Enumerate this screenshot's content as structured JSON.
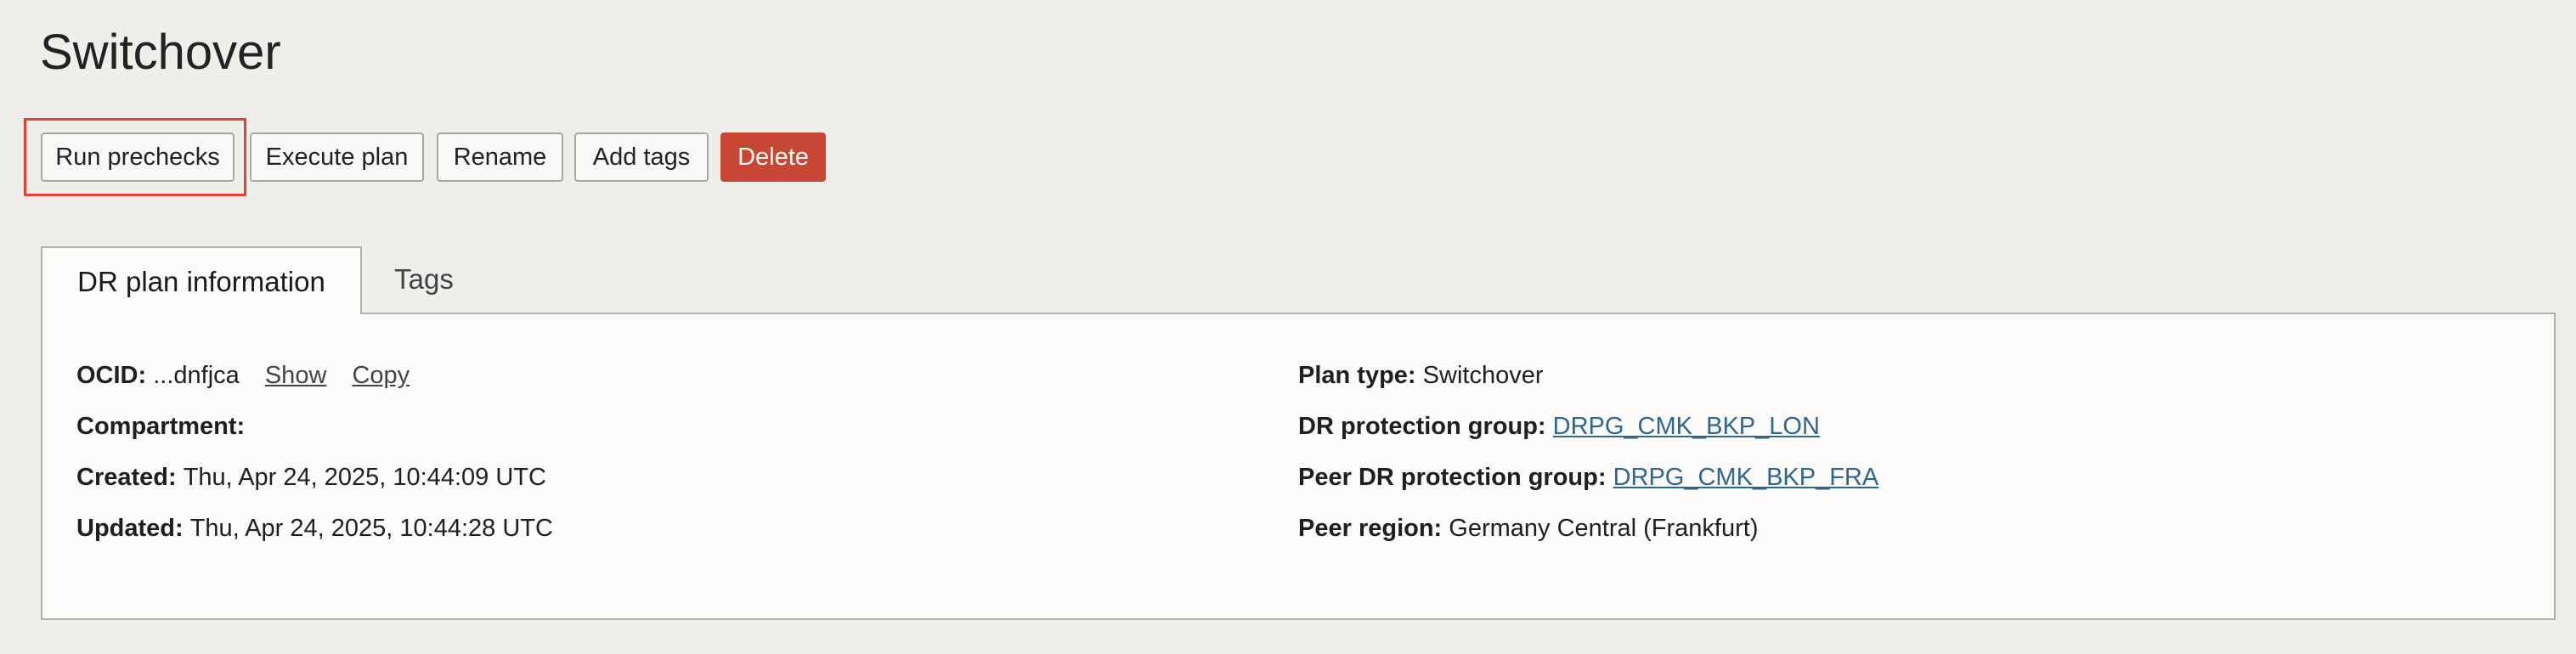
{
  "page": {
    "title": "Switchover"
  },
  "toolbar": {
    "run_prechecks_label": "Run prechecks",
    "execute_plan_label": "Execute plan",
    "rename_label": "Rename",
    "add_tags_label": "Add tags",
    "delete_label": "Delete"
  },
  "tabs": {
    "info_label": "DR plan information",
    "tags_label": "Tags"
  },
  "info": {
    "left": {
      "ocid_label": "OCID:",
      "ocid_value": "...dnfjca",
      "show_label": "Show",
      "copy_label": "Copy",
      "compartment_label": "Compartment:",
      "compartment_value": "",
      "created_label": "Created:",
      "created_value": "Thu, Apr 24, 2025, 10:44:09 UTC",
      "updated_label": "Updated:",
      "updated_value": "Thu, Apr 24, 2025, 10:44:28 UTC"
    },
    "right": {
      "plan_type_label": "Plan type:",
      "plan_type_value": "Switchover",
      "protection_group_label": "DR protection group:",
      "protection_group_value": "DRPG_CMK_BKP_LON",
      "peer_protection_group_label": "Peer DR protection group:",
      "peer_protection_group_value": "DRPG_CMK_BKP_FRA",
      "peer_region_label": "Peer region:",
      "peer_region_value": "Germany Central (Frankfurt)"
    }
  },
  "colors": {
    "background": "#efeeeb",
    "danger": "#c74634",
    "link": "#2d6690",
    "highlight": "#e8412c"
  }
}
